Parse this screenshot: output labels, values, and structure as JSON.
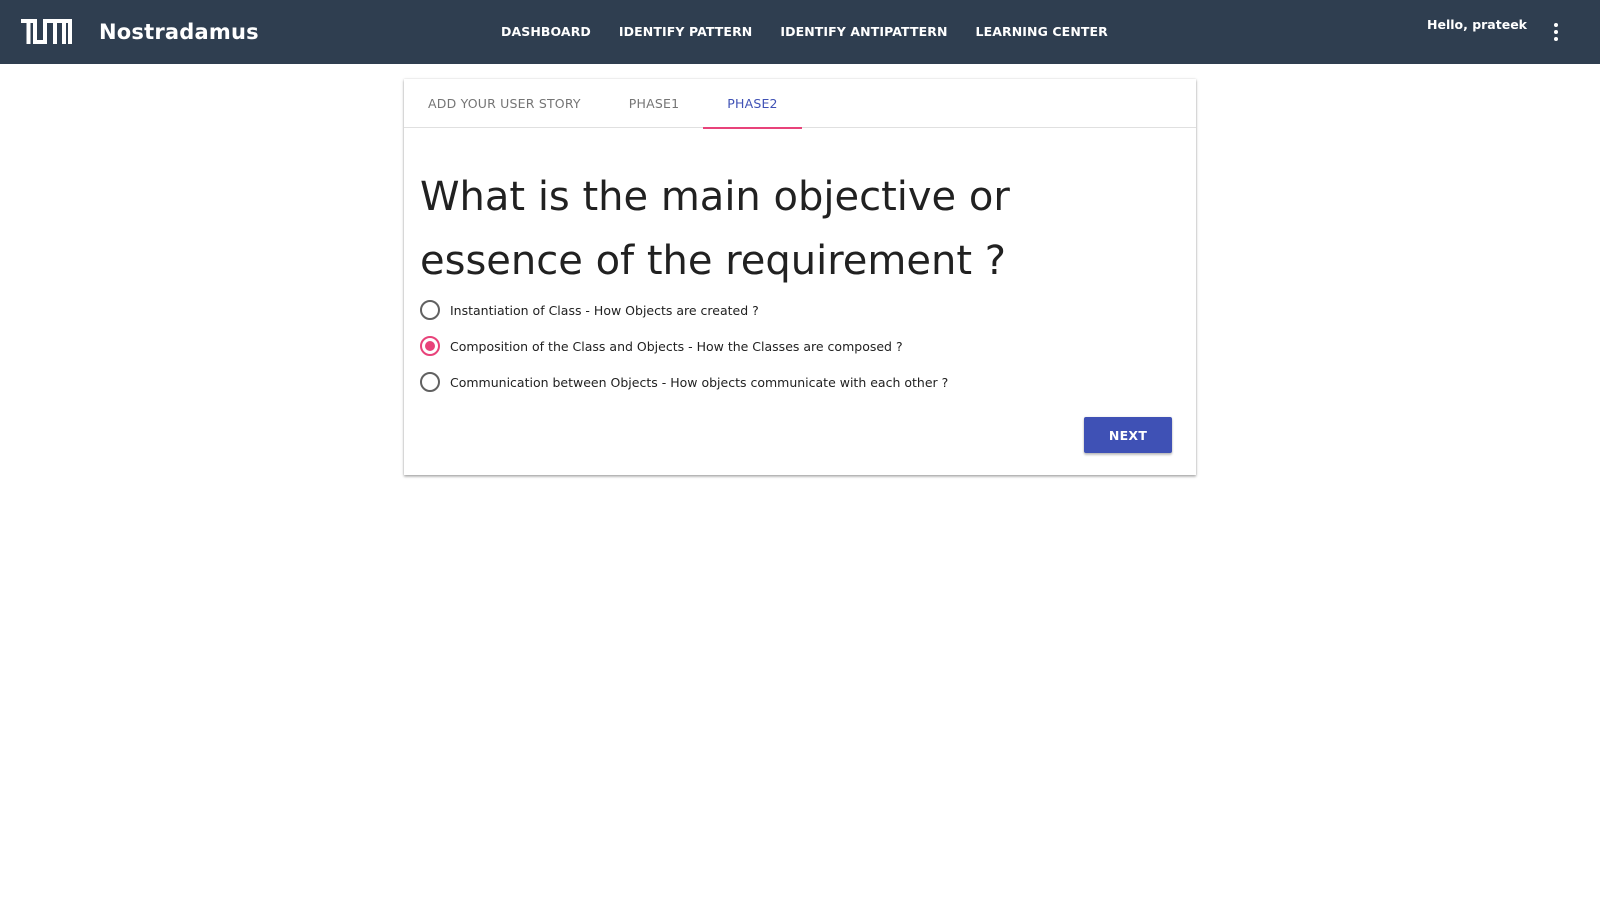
{
  "header": {
    "logo": "TUM",
    "app_title": "Nostradamus",
    "nav": [
      "DASHBOARD",
      "IDENTIFY PATTERN",
      "IDENTIFY ANTIPATTERN",
      "LEARNING CENTER"
    ],
    "greeting": "Hello, prateek",
    "more_icon": "more-vert-icon",
    "background_color": "#2f3e50"
  },
  "tabs": [
    {
      "label": "ADD YOUR USER STORY",
      "active": false
    },
    {
      "label": "PHASE1",
      "active": false
    },
    {
      "label": "PHASE2",
      "active": true
    }
  ],
  "question": "What is the main objective or essence of the requirement ?",
  "options": [
    {
      "label": "Instantiation of Class - How Objects are created ?",
      "selected": false
    },
    {
      "label": "Composition of the Class and Objects - How the Classes are composed ?",
      "selected": true
    },
    {
      "label": "Communication between Objects - How objects communicate with each other ?",
      "selected": false
    }
  ],
  "next_label": "NEXT",
  "colors": {
    "accent": "#e8437a",
    "primary": "#3f51b5"
  }
}
